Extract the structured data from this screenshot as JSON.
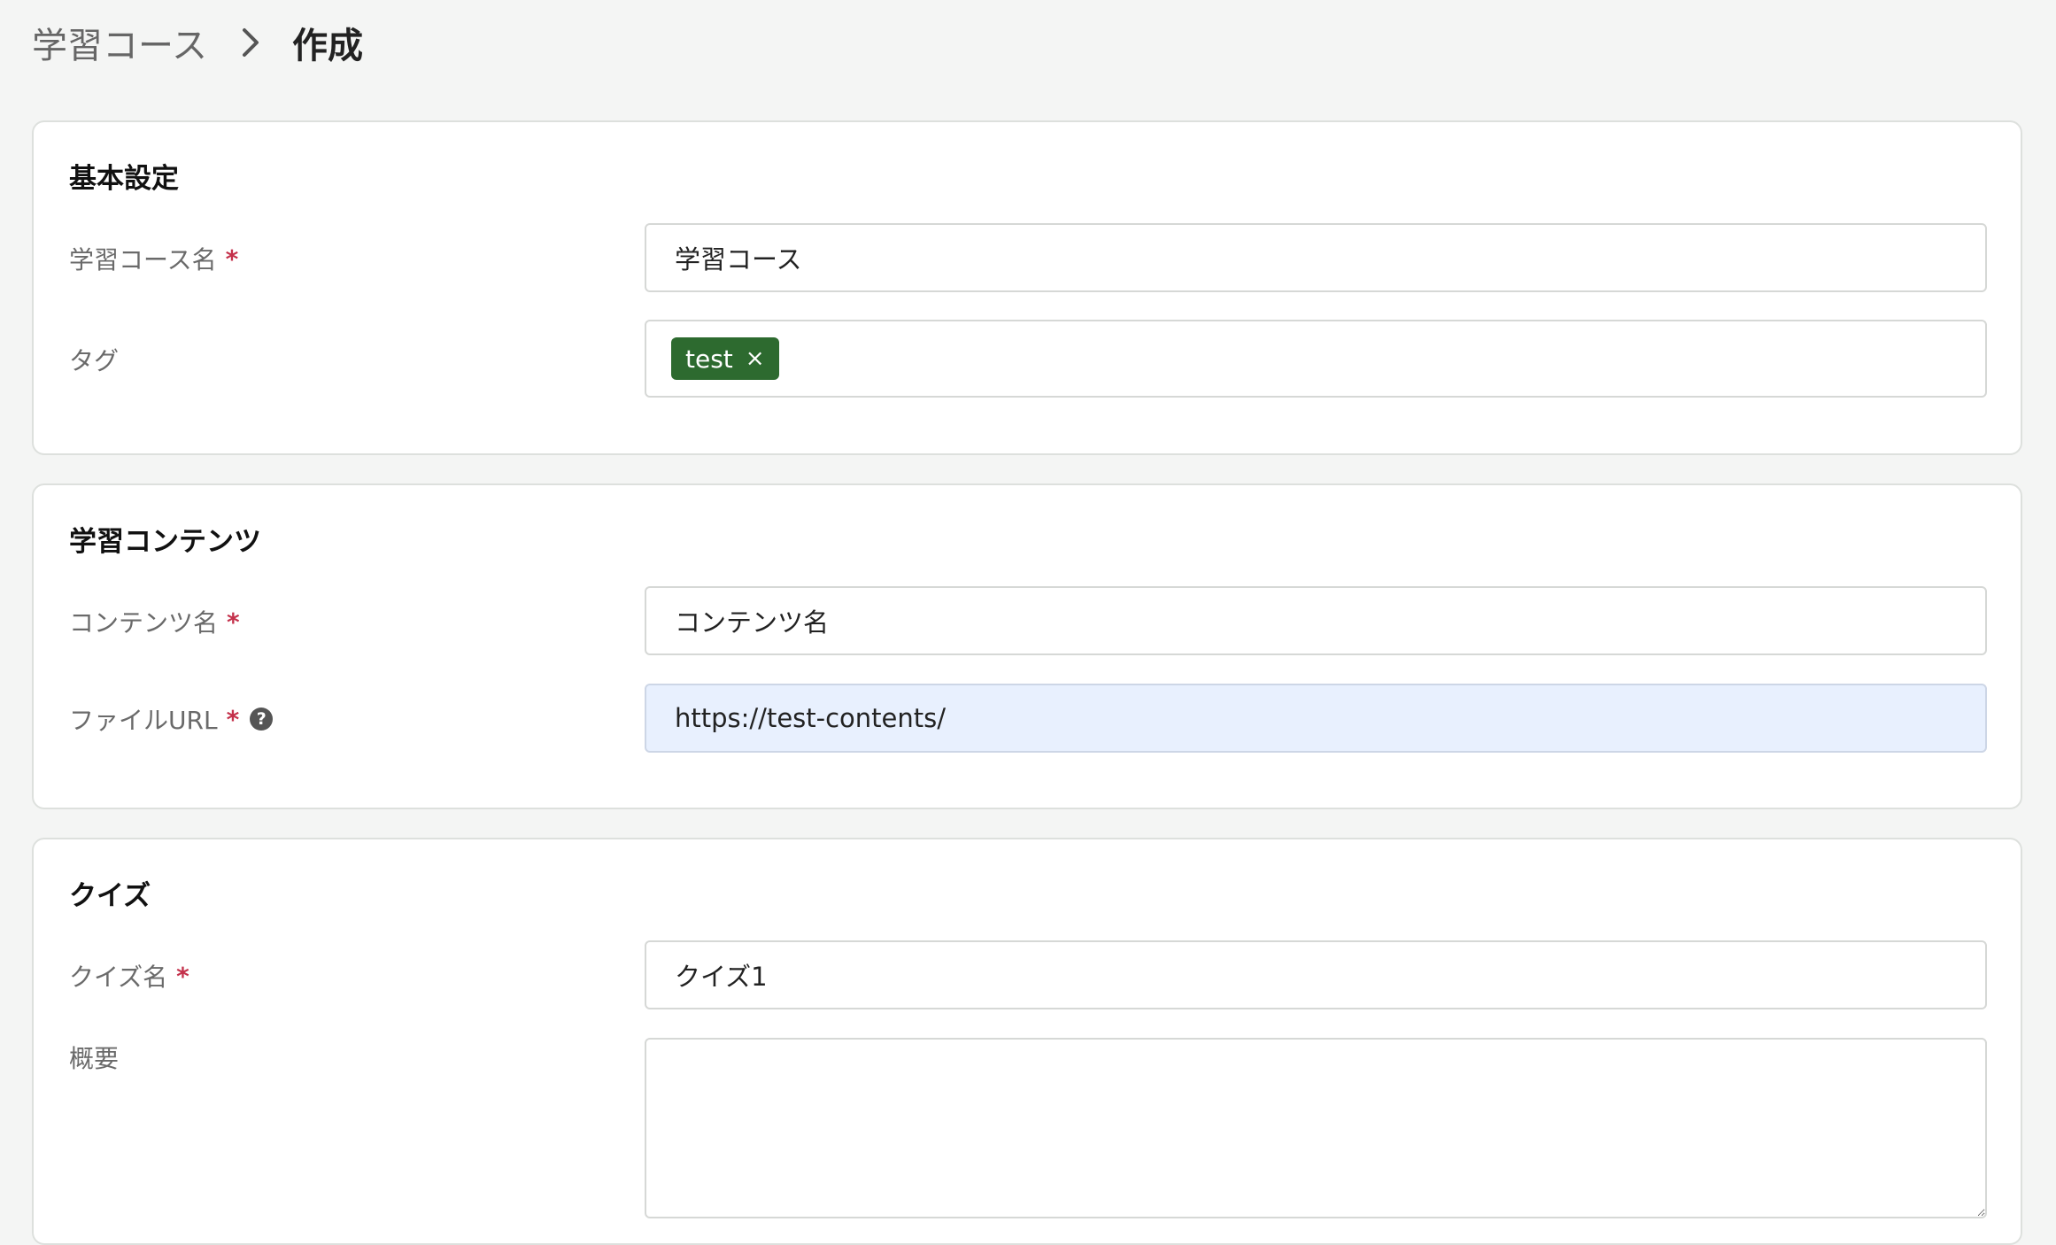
{
  "breadcrumb": {
    "parent": "学習コース",
    "separator_icon": "chevron-right-icon",
    "current": "作成"
  },
  "basic": {
    "title": "基本設定",
    "course_name": {
      "label": "学習コース名",
      "required": "*",
      "value": "学習コース"
    },
    "tags": {
      "label": "タグ",
      "items": [
        {
          "label": "test",
          "remove_icon": "×"
        }
      ]
    }
  },
  "content": {
    "title": "学習コンテンツ",
    "content_name": {
      "label": "コンテンツ名",
      "required": "*",
      "value": "コンテンツ名"
    },
    "file_url": {
      "label": "ファイルURL",
      "required": "*",
      "help_icon": "?",
      "value": "https://test-contents/"
    }
  },
  "quiz": {
    "title": "クイズ",
    "quiz_name": {
      "label": "クイズ名",
      "required": "*",
      "value": "クイズ1"
    },
    "summary": {
      "label": "概要",
      "value": ""
    }
  },
  "colors": {
    "tag_bg": "#2d6a2f",
    "required": "#c4314b",
    "autofill_bg": "#e8f0fe"
  }
}
